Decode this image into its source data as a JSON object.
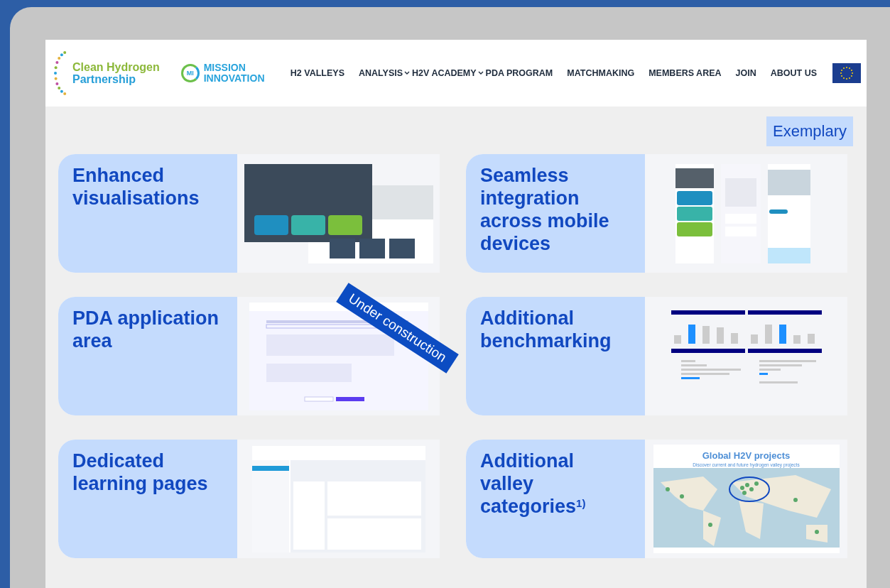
{
  "header": {
    "logo_primary": {
      "line1": "Clean Hydrogen",
      "line2": "Partnership"
    },
    "logo_secondary": {
      "badge": "MI",
      "line1": "MISSION",
      "line2": "INNOVATION"
    },
    "nav": [
      {
        "label": "H2 VALLEYS",
        "dropdown": false
      },
      {
        "label": "ANALYSIS",
        "dropdown": true
      },
      {
        "label": "H2V ACADEMY",
        "dropdown": true
      },
      {
        "label": "PDA PROGRAM",
        "dropdown": false
      },
      {
        "label": "MATCHMAKING",
        "dropdown": false
      },
      {
        "label": "MEMBERS AREA",
        "dropdown": false
      },
      {
        "label": "JOIN",
        "dropdown": false
      },
      {
        "label": "ABOUT US",
        "dropdown": false
      }
    ]
  },
  "tag": "Exemplary",
  "features": [
    {
      "title": "Enhanced visualisations",
      "preview": {
        "kind": "hero"
      }
    },
    {
      "title": "Seamless integration across mobile devices",
      "preview": {
        "kind": "mobile"
      }
    },
    {
      "title": "PDA application area",
      "preview": {
        "kind": "form",
        "ribbon": "Under construction"
      }
    },
    {
      "title": "Additional benchmarking",
      "preview": {
        "kind": "charts"
      }
    },
    {
      "title": "Dedicated learning pages",
      "preview": {
        "kind": "training"
      }
    },
    {
      "title": "Additional valley categories$^{1)}$",
      "preview": {
        "kind": "map",
        "title": "Global H2V projects",
        "subtitle": "Discover current and future hydrogen valley projects"
      }
    }
  ]
}
